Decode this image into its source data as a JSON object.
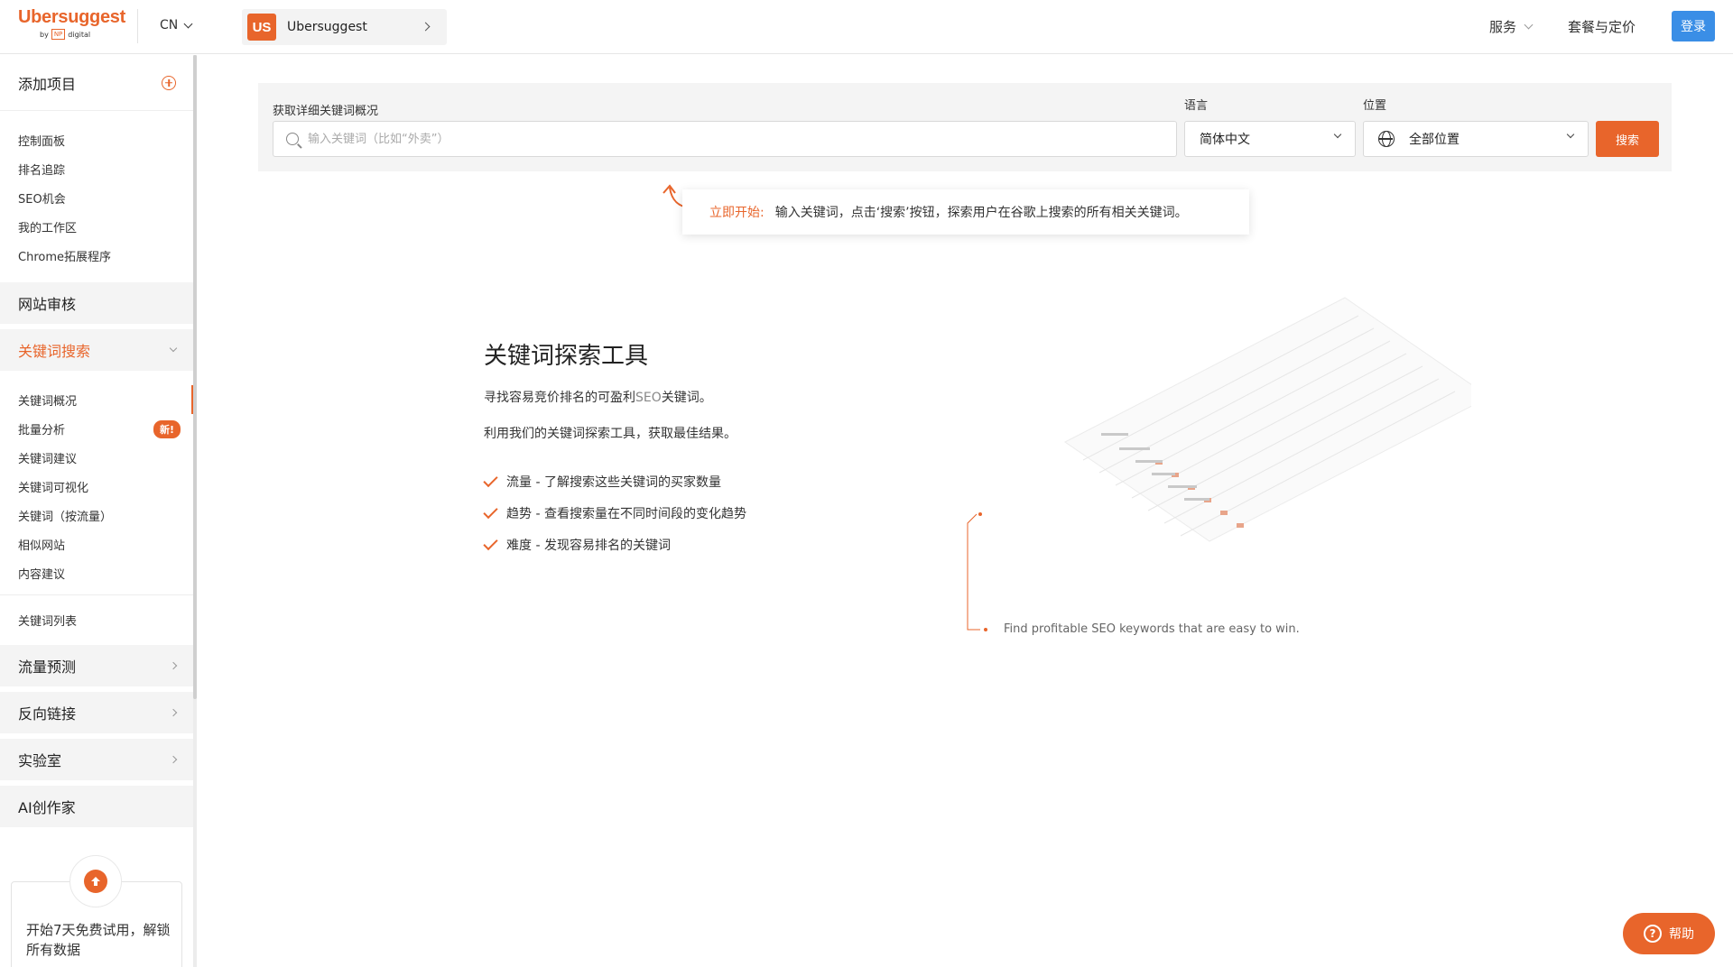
{
  "header": {
    "logo_main": "Ubersuggest",
    "logo_by": "by",
    "logo_np": "NP",
    "logo_digital": "digital",
    "lang": "CN",
    "project_avatar": "US",
    "project_name": "Ubersuggest",
    "nav_services": "服务",
    "nav_pricing": "套餐与定价",
    "login": "登录"
  },
  "sidebar": {
    "add_project": "添加项目",
    "top_items": [
      "控制面板",
      "排名追踪",
      "SEO机会",
      "我的工作区",
      "Chrome拓展程序"
    ],
    "site_audit": "网站审核",
    "keyword_research": "关键词搜索",
    "kw_items": [
      "关键词概况",
      "批量分析",
      "关键词建议",
      "关键词可视化",
      "关键词（按流量）",
      "相似网站",
      "内容建议"
    ],
    "new_badge": "新!",
    "keyword_lists": "关键词列表",
    "traffic_estimation": "流量预测",
    "backlinks": "反向链接",
    "labs": "实验室",
    "ai_writer": "AI创作家",
    "upgrade_text": "开始7天免费试用，解锁所有数据"
  },
  "search": {
    "label": "获取详细关键词概况",
    "placeholder": "输入关键词（比如“外卖”）",
    "value": "",
    "lang_label": "语言",
    "lang_value": "简体中文",
    "loc_label": "位置",
    "loc_value": "全部位置",
    "button": "搜索"
  },
  "hint": {
    "lead": "立即开始:",
    "text": "输入关键词，点击‘搜索’按钮，探索用户在谷歌上搜索的所有相关关键词。"
  },
  "intro": {
    "title": "关键词探索工具",
    "p1_pre": "寻找容易竞价排名的可盈利",
    "p1_seo": "SEO",
    "p1_post": "关键词。",
    "p2": "利用我们的关键词探索工具，获取最佳结果。",
    "features": [
      "流量 - 了解搜索这些关键词的买家数量",
      "趋势 - 查看搜索量在不同时间段的变化趋势",
      "难度 - 发现容易排名的关键词"
    ]
  },
  "illustration_caption": "Find profitable SEO keywords that are easy to win.",
  "help": {
    "label": "帮助"
  },
  "colors": {
    "accent": "#e8652b",
    "login": "#3a8ee6",
    "panel": "#f4f4f4"
  }
}
